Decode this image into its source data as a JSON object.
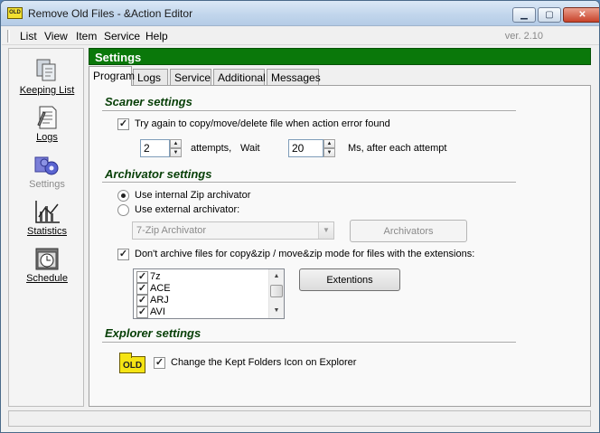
{
  "window": {
    "title": "Remove Old Files - &Action Editor",
    "app_icon_text": "OLD",
    "minimize": "▁",
    "maximize": "▢",
    "close": "✕"
  },
  "menu": {
    "items": [
      "List",
      "View",
      "Item",
      "Service",
      "Help"
    ],
    "version": "ver. 2.10"
  },
  "sidebar": {
    "items": [
      {
        "label": "Keeping List",
        "icon": "copy-files-icon",
        "enabled": true
      },
      {
        "label": "Logs",
        "icon": "log-document-icon",
        "enabled": true
      },
      {
        "label": "Settings",
        "icon": "gears-icon",
        "enabled": false
      },
      {
        "label": "Statistics",
        "icon": "chart-icon",
        "enabled": true
      },
      {
        "label": "Schedule",
        "icon": "clock-calendar-icon",
        "enabled": true
      }
    ]
  },
  "header": {
    "title": "Settings"
  },
  "tabs": [
    "Program",
    "Logs",
    "Service",
    "Additional",
    "Messages"
  ],
  "active_tab": "Program",
  "scaner": {
    "title": "Scaner settings",
    "retry_label": "Try again to copy/move/delete file when action error found",
    "retry_checked": true,
    "attempts_value": "2",
    "attempts_label": "attempts,",
    "wait_label": "Wait",
    "wait_value": "20",
    "wait_suffix": "Ms, after each attempt"
  },
  "archivator": {
    "title": "Archivator settings",
    "internal_label": "Use internal Zip archivator",
    "external_label": "Use external archivator:",
    "selected": "internal",
    "external_value": "7-Zip Archivator",
    "archivators_button": "Archivators",
    "dont_archive_label": "Don't archive files for copy&zip / move&zip mode for files with the extensions:",
    "dont_archive_checked": true,
    "extensions": [
      "7z",
      "ACE",
      "ARJ",
      "AVI"
    ],
    "extentions_button": "Extentions"
  },
  "explorer": {
    "title": "Explorer settings",
    "icon_text": "OLD",
    "change_icon_label": "Change the Kept Folders Icon on Explorer",
    "change_icon_checked": true
  },
  "colors": {
    "header_green": "#0a780a",
    "section_title": "#073f07"
  }
}
